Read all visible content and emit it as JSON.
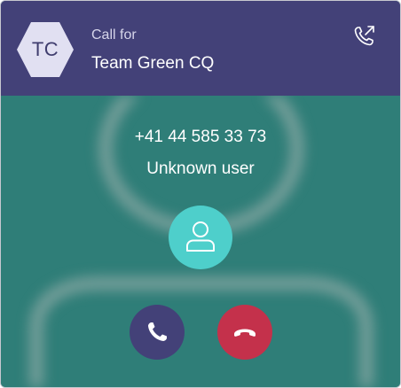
{
  "header": {
    "avatar_initials": "TC",
    "call_for_label": "Call for",
    "team_name": "Team Green CQ",
    "transfer_icon": "phone-forward-icon"
  },
  "call": {
    "phone_number": "+41 44 585 33 73",
    "caller_name": "Unknown user",
    "caller_avatar_icon": "person-icon"
  },
  "actions": {
    "accept_icon": "phone-icon",
    "decline_icon": "hang-up-icon"
  },
  "colors": {
    "header_bg": "#434178",
    "body_bg": "#2f7e78",
    "avatar_hex_bg": "#e1e0f2",
    "caller_avatar_bg": "#4ecfcb",
    "accept_bg": "#434178",
    "decline_bg": "#c4314b"
  }
}
